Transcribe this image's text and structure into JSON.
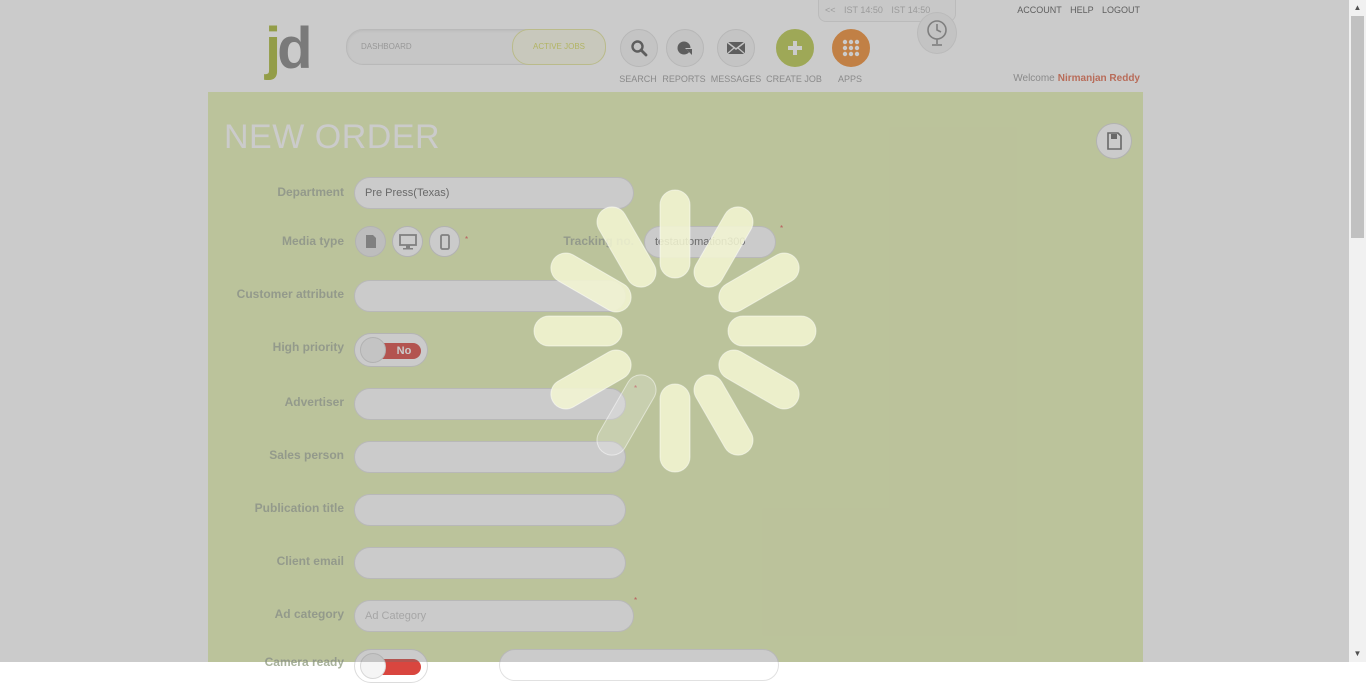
{
  "header": {
    "logo_j": "j",
    "logo_d": "d",
    "dashboard_label": "DASHBOARD",
    "active_jobs_label": "ACTIVE JOBS",
    "nav": [
      {
        "label": "SEARCH",
        "icon": "search-icon"
      },
      {
        "label": "REPORTS",
        "icon": "reports-icon"
      },
      {
        "label": "MESSAGES",
        "icon": "messages-icon"
      },
      {
        "label": "CREATE JOB",
        "icon": "plus-icon"
      },
      {
        "label": "APPS",
        "icon": "apps-grid-icon"
      }
    ],
    "clock_prev": "<<",
    "clock_1": "IST 14:50",
    "clock_2": "IST 14:50",
    "links": {
      "account": "ACCOUNT",
      "help": "HELP",
      "logout": "LOGOUT"
    },
    "welcome_text": "Welcome",
    "user_name": "Nirmanjan Reddy"
  },
  "form": {
    "title": "NEW ORDER",
    "department": {
      "label": "Department",
      "value": "Pre Press(Texas)"
    },
    "media_type": {
      "label": "Media type",
      "options": [
        "print-icon",
        "monitor-icon",
        "mobile-icon"
      ],
      "selected": "print-icon"
    },
    "tracking_no": {
      "label": "Tracking no.",
      "value": "testautomation300"
    },
    "customer_attribute": {
      "label": "Customer attribute",
      "value": ""
    },
    "high_priority": {
      "label": "High priority",
      "value": "No"
    },
    "advertiser": {
      "label": "Advertiser",
      "value": ""
    },
    "sales_person": {
      "label": "Sales person",
      "value": ""
    },
    "publication_title": {
      "label": "Publication title",
      "value": ""
    },
    "client_email": {
      "label": "Client email",
      "value": ""
    },
    "ad_category": {
      "label": "Ad category",
      "placeholder": "Ad Category"
    },
    "camera_ready": {
      "label": "Camera ready"
    },
    "required_mark": "*"
  },
  "overlay": {
    "state": "loading",
    "icon": "loading-spinner-icon"
  },
  "colors": {
    "brand_green": "#a8b832",
    "panel_bg": "#e7f2b5",
    "create_job": "#b9c94a",
    "apps": "#f08a2e",
    "user_name": "#e26b4e",
    "toggle_no": "#d9463f"
  }
}
